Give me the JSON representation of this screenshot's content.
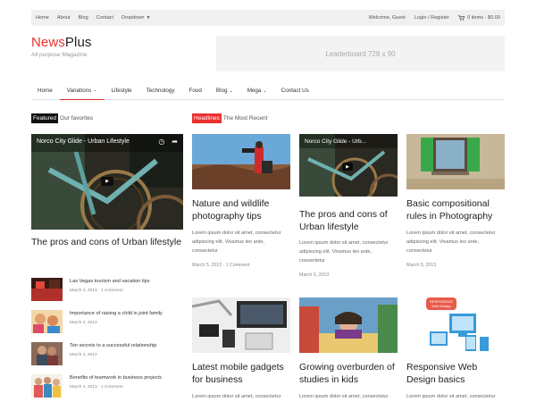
{
  "topbar": {
    "links": [
      "Home",
      "About",
      "Blog",
      "Contact"
    ],
    "dropdown": "Dropdown",
    "welcome": "Welcome, Guest",
    "login": "Login / Register",
    "cart": "0 items - $0.00"
  },
  "header": {
    "logo_news": "News",
    "logo_plus": "Plus",
    "tagline": "All purpose Magazine",
    "leaderboard": "Leaderboard 728 x 90"
  },
  "nav": {
    "items": [
      "Home",
      "Variations",
      "Lifestyle",
      "Technology",
      "Food",
      "Blog",
      "Mega",
      "Contact Us"
    ]
  },
  "featured": {
    "tag": "Featured",
    "rest": "Our favorites",
    "video_title": "Norco City Glide - Urban Lifestyle",
    "title": "The pros and cons of Urban lifestyle",
    "list": [
      {
        "title": "Las Vegas tourism and vacation tips",
        "meta": "March 4, 2013 · 1 Comment"
      },
      {
        "title": "Importance of raising a child in joint family",
        "meta": "March 4, 2013"
      },
      {
        "title": "Ten secrets to a successful relationship",
        "meta": "March 4, 2013"
      },
      {
        "title": "Benefits of teamwork in business projects",
        "meta": "March 4, 2013 · 1 Comment"
      }
    ]
  },
  "headlines": {
    "tag": "Headlines",
    "rest": "The Most Recent",
    "cards": [
      {
        "title_l1": "Nature and wildlife",
        "title_l2": "photography tips",
        "excerpt_l1": "Lorem ipsum dolor sit amet, consectetur",
        "excerpt_l2": "adipiscing elit. Vivamus leo ante,",
        "excerpt_l3": "consectetur",
        "meta": "March 5, 2013 · 1 Comment"
      },
      {
        "video_title": "Norco City Glide - Urb...",
        "title_l1": "The pros and cons of",
        "title_l2": "Urban lifestyle",
        "excerpt_l1": "Lorem ipsum dolor sit amet, consectetur",
        "excerpt_l2": "adipiscing elit. Vivamus leo ante,",
        "excerpt_l3": "consectetur",
        "meta": "March 5, 2013"
      },
      {
        "title_l1": "Basic compositional",
        "title_l2": "rules in Photography",
        "excerpt_l1": "Lorem ipsum dolor sit amet, consectetur",
        "excerpt_l2": "adipiscing elit. Vivamus leo ante,",
        "excerpt_l3": "consectetur",
        "meta": "March 5, 2013"
      },
      {
        "title_l1": "Latest mobile gadgets",
        "title_l2": "for business",
        "excerpt_l1": "Lorem ipsum dolor sit amet, consectetur"
      },
      {
        "title_l1": "Growing overburden of",
        "title_l2": "studies in kids",
        "excerpt_l1": "Lorem ipsum dolor sit amet, consectetur"
      },
      {
        "badge_l1": "RESPONSIVE",
        "badge_l2": "Web Design",
        "title_l1": "Responsive Web",
        "title_l2": "Design basics",
        "excerpt_l1": "Lorem ipsum dolor sit amet, consectetur"
      }
    ]
  },
  "colors": {
    "accent": "#e8312f",
    "featured_tag": "#111111",
    "headlines_tag": "#e8312f"
  }
}
